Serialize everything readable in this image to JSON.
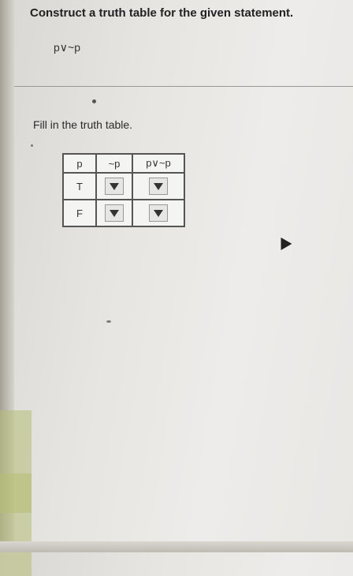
{
  "question": "Construct a truth table for the given statement.",
  "statement": "p∨~p",
  "instruction": "Fill in the truth table.",
  "truth_table": {
    "headers": [
      "p",
      "~p",
      "p∨~p"
    ],
    "rows": [
      {
        "p": "T"
      },
      {
        "p": "F"
      }
    ]
  },
  "icons": {
    "dropdown": "dropdown-arrow-icon",
    "pointer": "mouse-pointer-icon"
  }
}
